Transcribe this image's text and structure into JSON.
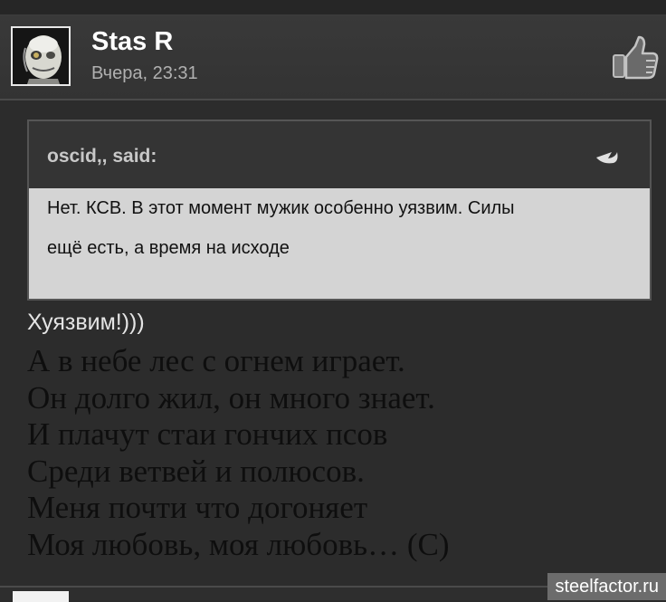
{
  "post": {
    "username": "Stas R",
    "timestamp": "Вчера, 23:31",
    "like_icon": "thumbs-up-icon",
    "avatar_icon": "avatar-mask"
  },
  "quote": {
    "author": "oscid,, said:",
    "arrow_icon": "reply-arrow-icon",
    "lines": [
      "Нет. КСВ. В этот момент мужик особенно уязвим. Силы",
      "ещё есть, а время на исходе"
    ]
  },
  "reply": "Хуязвим!)))",
  "poem": [
    "А в небе лес с огнем играет.",
    "Он долго жил, он много знает.",
    "И плачут стаи гончих псов",
    "Среди ветвей и полюсов.",
    "Меня почти что догоняет",
    "Моя любовь, моя любовь… (С)"
  ],
  "watermark": "steelfactor.ru",
  "colors": {
    "background": "#2a2a2a",
    "header": "#363636",
    "quote_body": "#d4d4d4",
    "username": "#ffffff",
    "timestamp": "#b0b0b0"
  }
}
